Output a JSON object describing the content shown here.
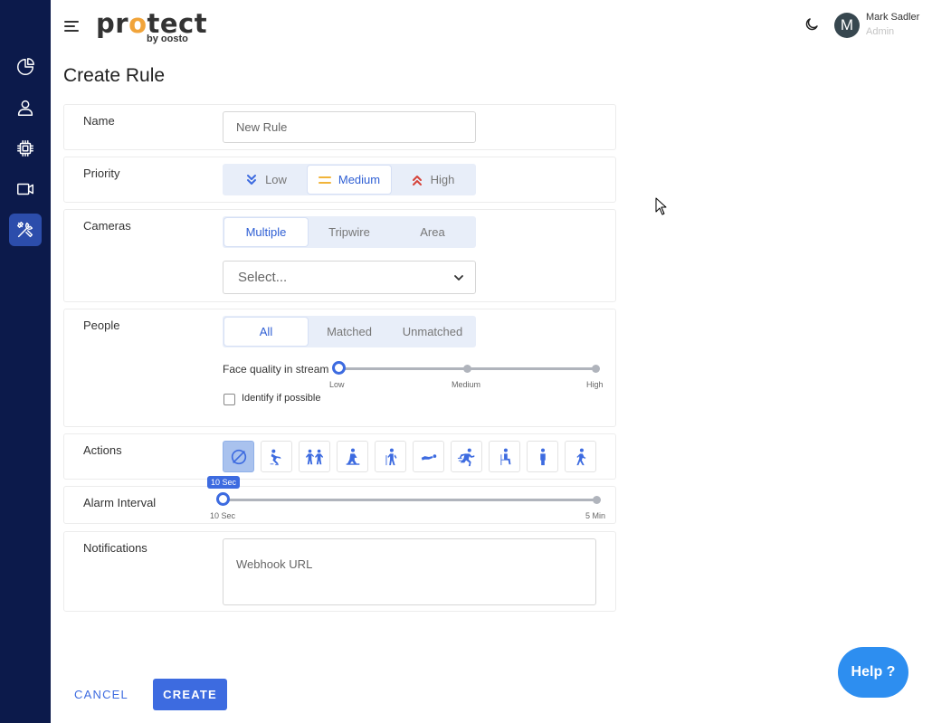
{
  "header": {
    "logo_text_a": "pr",
    "logo_text_o": "o",
    "logo_text_b": "tect",
    "logo_sub": "by oosto",
    "user_name": "Mark Sadler",
    "user_role": "Admin",
    "avatar_initial": "M"
  },
  "sidebar": {
    "items": [
      {
        "icon": "pie-chart-icon"
      },
      {
        "icon": "user-icon"
      },
      {
        "icon": "chip-icon"
      },
      {
        "icon": "video-camera-icon"
      },
      {
        "icon": "tools-icon",
        "active": true
      }
    ]
  },
  "page": {
    "title": "Create Rule"
  },
  "form": {
    "name": {
      "label": "Name",
      "placeholder": "New Rule"
    },
    "priority": {
      "label": "Priority",
      "options": [
        "Low",
        "Medium",
        "High"
      ],
      "selected": "Medium"
    },
    "cameras": {
      "label": "Cameras",
      "options": [
        "Multiple",
        "Tripwire",
        "Area"
      ],
      "selected": "Multiple",
      "select_placeholder": "Select..."
    },
    "people": {
      "label": "People",
      "options": [
        "All",
        "Matched",
        "Unmatched"
      ],
      "selected": "All",
      "face_quality_label": "Face quality in stream",
      "face_quality_ticks": [
        "Low",
        "Medium",
        "High"
      ],
      "face_quality_value": "Low",
      "identify_label": "Identify if possible",
      "identify_checked": false
    },
    "actions": {
      "label": "Actions",
      "icons": [
        "none-icon",
        "falling-person-icon",
        "fighting-icon",
        "crouching-person-icon",
        "person-with-cane-icon",
        "lying-person-icon",
        "running-person-icon",
        "sitting-person-icon",
        "standing-person-icon",
        "walking-person-icon"
      ],
      "selected_index": 0
    },
    "alarm_interval": {
      "label": "Alarm Interval",
      "value_label": "10 Sec",
      "min_label": "10 Sec",
      "max_label": "5 Min",
      "value_fraction": 0
    },
    "notifications": {
      "label": "Notifications",
      "placeholder": "Webhook URL"
    }
  },
  "buttons": {
    "cancel": "CANCEL",
    "create": "CREATE",
    "help": "Help ?"
  },
  "colors": {
    "sidebar": "#0c1a4b",
    "accent": "#3d6be0",
    "low": "#3d6be0",
    "medium": "#f1b43a",
    "high": "#d6433a",
    "help": "#2d8ef0"
  }
}
